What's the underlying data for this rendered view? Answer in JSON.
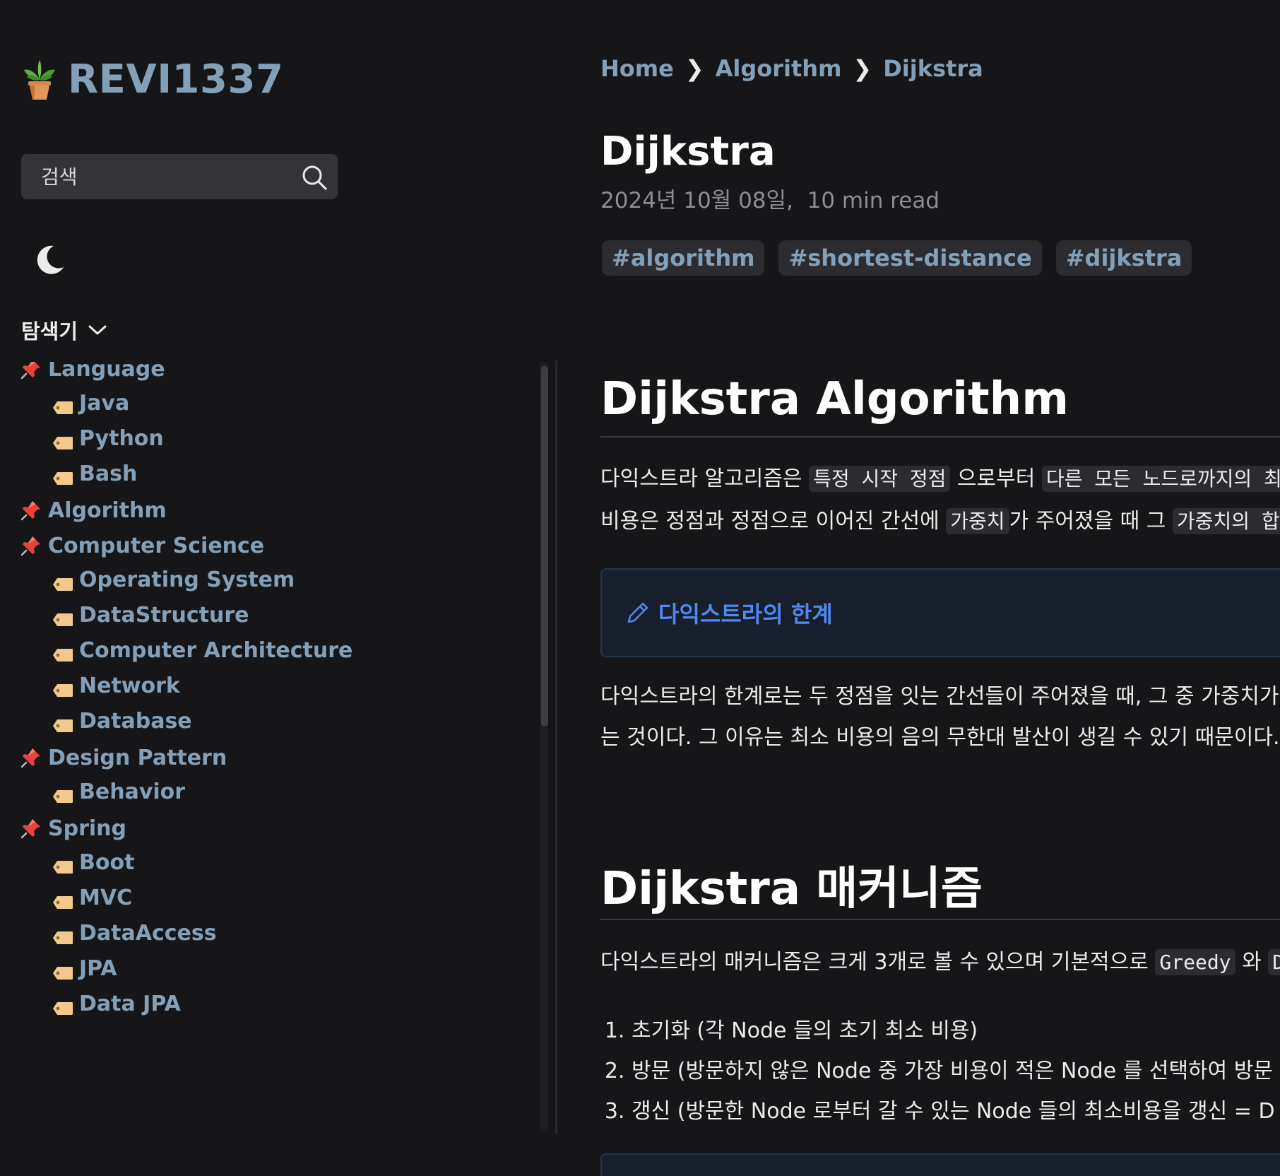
{
  "site": {
    "logo_text": "REVI1337"
  },
  "search": {
    "placeholder": "검색"
  },
  "explorer": {
    "title": "탐색기",
    "folders": [
      {
        "label": "Language",
        "notes": [
          "Java",
          "Python",
          "Bash"
        ]
      },
      {
        "label": "Algorithm",
        "notes": []
      },
      {
        "label": "Computer Science",
        "notes": [
          "Operating System",
          "DataStructure",
          "Computer Architecture",
          "Network",
          "Database"
        ]
      },
      {
        "label": "Design Pattern",
        "notes": [
          "Behavior"
        ]
      },
      {
        "label": "Spring",
        "notes": [
          "Boot",
          "MVC",
          "DataAccess",
          "JPA",
          "Data JPA"
        ]
      }
    ]
  },
  "breadcrumb": [
    "Home",
    "Algorithm",
    "Dijkstra"
  ],
  "article": {
    "title": "Dijkstra",
    "date": "2024년 10월 08일",
    "read_time": "10 min read",
    "tags": [
      "#algorithm",
      "#shortest-distance",
      "#dijkstra"
    ],
    "section1": {
      "heading": "Dijkstra Algorithm",
      "p1": {
        "t1": "다익스트라 알고리즘은 ",
        "c1": "특정 시작 정점",
        "t2": " 으로부터 ",
        "c2": "다른 모든 노드로까지의 최소"
      },
      "p2": {
        "t1": "비용은 정점과 정점으로 이어진 간선에 ",
        "c1": "가중치",
        "t2": "가 주어졌을 때 그 ",
        "c2": "가중치의 합이"
      },
      "callout_title": "다익스트라의 한계",
      "p3": "다익스트라의 한계로는 두 정점을 잇는 간선들이 주어졌을 때, 그 중 가중치가 음",
      "p4": "는 것이다. 그 이유는 최소 비용의 음의 무한대 발산이 생길 수 있기 때문이다. 이"
    },
    "section2": {
      "heading": "Dijkstra 매커니즘",
      "p1": {
        "t1": "다익스트라의 매커니즘은 크게 3개로 볼 수 있으며 기본적으로 ",
        "c1": "Greedy",
        "t2": " 와 ",
        "c2": "D"
      },
      "steps": [
        "초기화 (각 Node 들의 초기 최소 비용)",
        "방문 (방문하지 않은 Node 중 가장 비용이 적은 Node 를 선택하여 방문",
        "갱신 (방문한 Node 로부터 갈 수 있는 Node 들의 최소비용을 갱신 = D"
      ]
    }
  },
  "colors": {
    "background": "#161618",
    "link": "#84a0b8",
    "callout_accent": "#4f88f0"
  }
}
